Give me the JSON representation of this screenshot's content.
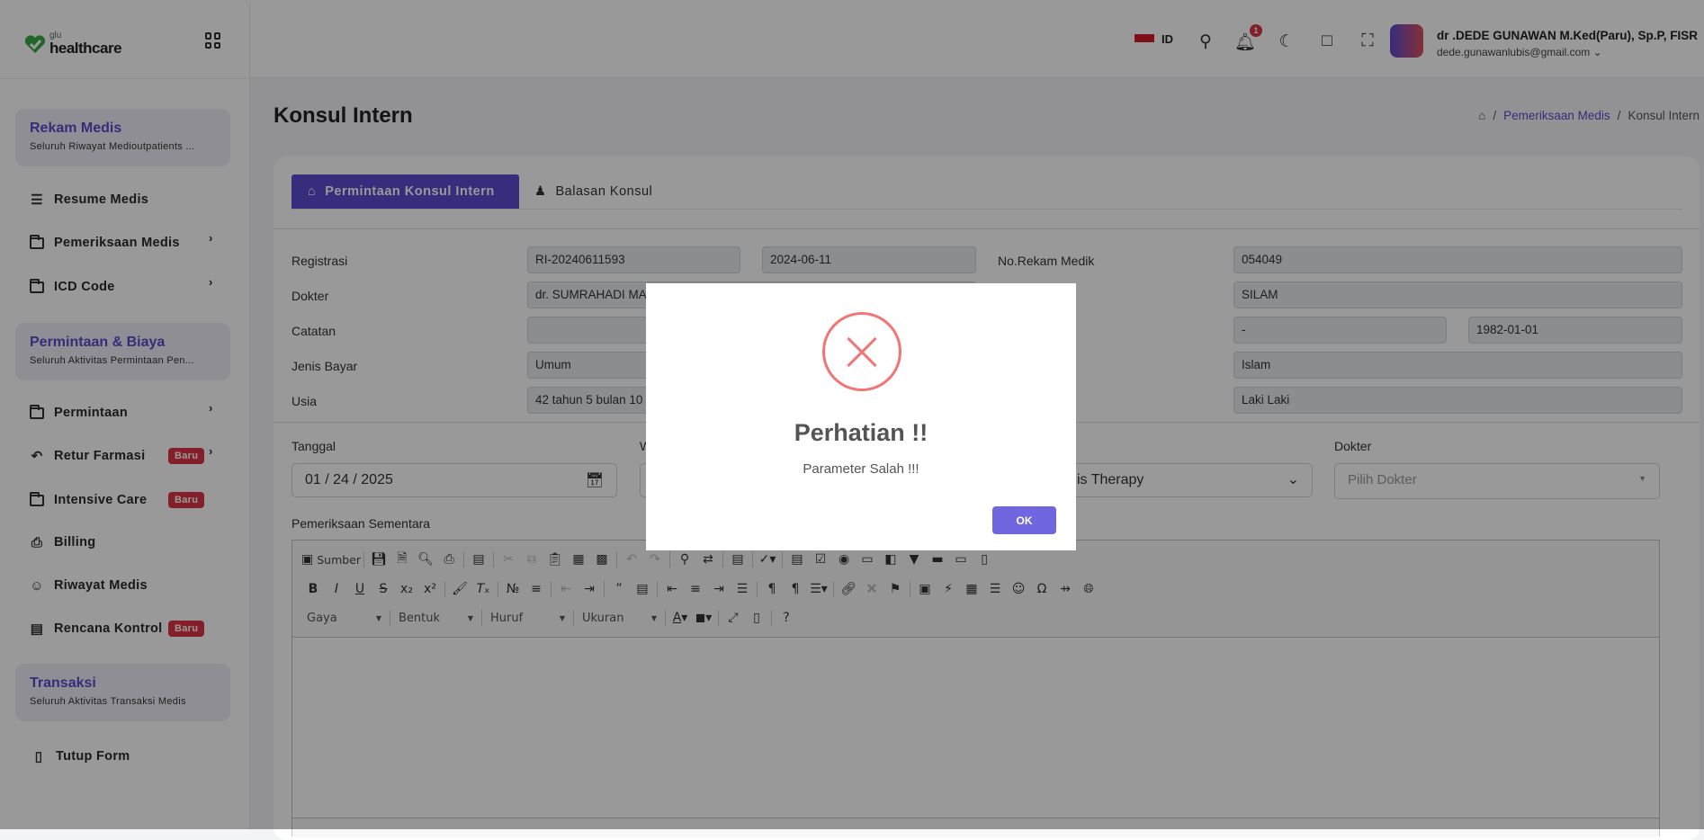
{
  "app": {
    "logo_small": "glu",
    "logo_big": "healthcare"
  },
  "sidebar": {
    "sections": [
      {
        "title": "Rekam Medis",
        "subtitle": "Seluruh Riwayat Medioutpatients ..."
      },
      {
        "title": "Permintaan & Biaya",
        "subtitle": "Seluruh Aktivitas Permintaan Pen..."
      },
      {
        "title": "Transaksi",
        "subtitle": "Seluruh Aktivitas Transaksi Medis"
      }
    ],
    "items": [
      {
        "label": "Resume Medis",
        "icon": "list-icon"
      },
      {
        "label": "Pemeriksaan Medis",
        "icon": "folder-icon",
        "chevron": true
      },
      {
        "label": "ICD Code",
        "icon": "folder-icon",
        "chevron": true
      },
      {
        "label": "Permintaan",
        "icon": "folder-icon",
        "chevron": true
      },
      {
        "label": "Retur Farmasi",
        "icon": "arrow-left-circle-icon",
        "badge": "Baru",
        "chevron": true
      },
      {
        "label": "Intensive Care",
        "icon": "folder-icon",
        "badge": "Baru"
      },
      {
        "label": "Billing",
        "icon": "printer-icon"
      },
      {
        "label": "Riwayat Medis",
        "icon": "user-icon"
      },
      {
        "label": "Rencana Kontrol",
        "icon": "document-icon",
        "badge": "Baru"
      },
      {
        "label": "Tutup Form",
        "icon": "file-icon"
      }
    ]
  },
  "header": {
    "lang": "ID",
    "notifications": "1",
    "user_name": "dr .DEDE GUNAWAN M.Ked(Paru), Sp.P, FISR",
    "user_email": "dede.gunawanlubis@gmail.com"
  },
  "page": {
    "title": "Konsul Intern",
    "breadcrumb": [
      "Pemeriksaan Medis",
      "Konsul Intern"
    ]
  },
  "tabs": [
    "Permintaan Konsul Intern",
    "Balasan Konsul"
  ],
  "form": {
    "registrasi_label": "Registrasi",
    "registrasi": "RI-20240611593",
    "reg_date": "2024-06-11",
    "dokter_label": "Dokter",
    "dokter": "dr. SUMRAHADI MA",
    "catatan_label": "Catatan",
    "catatan": "",
    "jenis_bayar_label": "Jenis Bayar",
    "jenis_bayar": "Umum",
    "usia_label": "Usia",
    "usia": "42 tahun 5 bulan 10",
    "no_rm_label": "No.Rekam Medik",
    "no_rm": "054049",
    "nama": "SILAM",
    "field_dash": "-",
    "tgl_lahir": "1982-01-01",
    "agama": "Islam",
    "jenis_kelamin": "Laki Laki",
    "tanggal_label": "Tanggal",
    "tanggal": "01 / 24 / 2025",
    "w_label": "W",
    "poli_value": "is Therapy",
    "dokter2_label": "Dokter",
    "dokter2_placeholder": "Pilih Dokter",
    "pemeriksaan_label": "Pemeriksaan Sementara"
  },
  "editor": {
    "source_label": "Sumber",
    "row1": [
      "save",
      "new-page",
      "preview",
      "print",
      "|",
      "templates",
      "|",
      "cut*",
      "copy*",
      "paste",
      "paste-text",
      "paste-word",
      "|",
      "undo*",
      "redo*",
      "|",
      "find",
      "replace",
      "|",
      "select-all",
      "|",
      "spellcheck",
      "|",
      "form",
      "checkbox",
      "radio",
      "textfield",
      "textarea",
      "select",
      "button",
      "image-button",
      "hidden-field"
    ],
    "row2": [
      "bold",
      "italic",
      "underline",
      "strike",
      "subscript",
      "superscript",
      "|",
      "copy-format",
      "remove-format",
      "|",
      "numbered-list",
      "bulleted-list",
      "|",
      "outdent*",
      "indent",
      "|",
      "blockquote",
      "div",
      "|",
      "align-left",
      "align-center",
      "align-right",
      "justify",
      "|",
      "ltr",
      "rtl",
      "language",
      "|",
      "link",
      "unlink*",
      "anchor",
      "|",
      "image",
      "flash",
      "table",
      "horizontal-rule",
      "smiley",
      "special-char",
      "page-break",
      "iframe"
    ],
    "combos": [
      "Gaya",
      "Bentuk",
      "Huruf",
      "Ukuran"
    ],
    "row3": [
      "text-color",
      "bg-color",
      "|",
      "maximize",
      "show-blocks",
      "|",
      "help"
    ]
  },
  "modal": {
    "title": "Perhatian !!",
    "message": "Parameter Salah !!!",
    "ok": "OK",
    "icon": "error-x-icon",
    "icon_color": "#f27474",
    "button_color": "#7066e0"
  }
}
